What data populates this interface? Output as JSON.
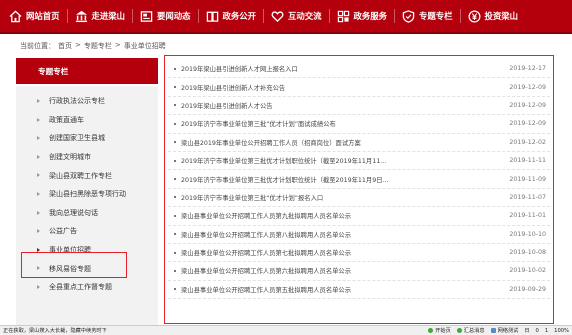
{
  "nav": {
    "items": [
      {
        "label": "网站首页",
        "icon": "home-icon"
      },
      {
        "label": "走进梁山",
        "icon": "building-icon"
      },
      {
        "label": "要闻动态",
        "icon": "news-icon"
      },
      {
        "label": "政务公开",
        "icon": "book-icon"
      },
      {
        "label": "互动交流",
        "icon": "heart-icon"
      },
      {
        "label": "政务服务",
        "icon": "service-icon"
      },
      {
        "label": "专题专栏",
        "icon": "shield-icon"
      },
      {
        "label": "投资梁山",
        "icon": "yen-icon"
      }
    ]
  },
  "breadcrumb": {
    "prefix": "当前位置：",
    "home": "首页",
    "sep1": ">",
    "section": "专题专栏",
    "sep2": ">",
    "current": "事业单位招聘"
  },
  "sidebar": {
    "title": "专题专栏",
    "items": [
      {
        "label": "行政执法公示专栏",
        "active": false
      },
      {
        "label": "政策直通车",
        "active": false
      },
      {
        "label": "创建国家卫生县城",
        "active": false
      },
      {
        "label": "创建文明城市",
        "active": false
      },
      {
        "label": "梁山县双聘工作专栏",
        "active": false
      },
      {
        "label": "梁山县扫黑除恶专项行动",
        "active": false
      },
      {
        "label": "我向总理说句话",
        "active": false
      },
      {
        "label": "公益广告",
        "active": false
      },
      {
        "label": "事业单位招聘",
        "active": true
      },
      {
        "label": "移风易俗专题",
        "active": false
      },
      {
        "label": "全县重点工作督专题",
        "active": false
      }
    ]
  },
  "articles": [
    {
      "title": "2019年梁山县引进创新人才网上报名入口",
      "date": "2019-12-17"
    },
    {
      "title": "2019年梁山县引进创新人才补充公告",
      "date": "2019-12-09"
    },
    {
      "title": "2019年梁山县引进创新人才公告",
      "date": "2019-12-09"
    },
    {
      "title": "2019年济宁市事业单位第三批“优才计划”面试成绩公布",
      "date": "2019-12-09"
    },
    {
      "title": "梁山县2019年事业单位公开招聘工作人员（招商岗位）面试方案",
      "date": "2019-12-02"
    },
    {
      "title": "2019年济宁市事业单位第三批优才计划职位统计（截至2019年11月11...",
      "date": "2019-11-11"
    },
    {
      "title": "2019年济宁市事业单位第三批优才计划职位统计（截至2019年11月9日...",
      "date": "2019-11-09"
    },
    {
      "title": "2019年济宁市事业单位第三批“优才计划”报名入口",
      "date": "2019-11-07"
    },
    {
      "title": "梁山县事业单位公开招聘工作人员第九批拟聘用人员名单公示",
      "date": "2019-11-01"
    },
    {
      "title": "梁山县事业单位公开招聘工作人员第八批拟聘用人员名单公示",
      "date": "2019-10-10"
    },
    {
      "title": "梁山县事业单位公开招聘工作人员第七批拟聘用人员名单公示",
      "date": "2019-10-08"
    },
    {
      "title": "梁山县事业单位公开招聘工作人员第六批拟聘用人员名单公示",
      "date": "2019-10-02"
    },
    {
      "title": "梁山县事业单位公开招聘工作人员第五批拟聘用人员名单公示",
      "date": "2019-09-29"
    }
  ],
  "statusbar": {
    "left": "正在获取，梁山搜入大长裁，隐藏中续务时下",
    "items": [
      "开始页",
      "汇总消息",
      "网络测试",
      "日",
      "0",
      "1",
      "100%"
    ]
  },
  "colors": {
    "brand": "#b3000c",
    "highlight": "#e8202a"
  }
}
